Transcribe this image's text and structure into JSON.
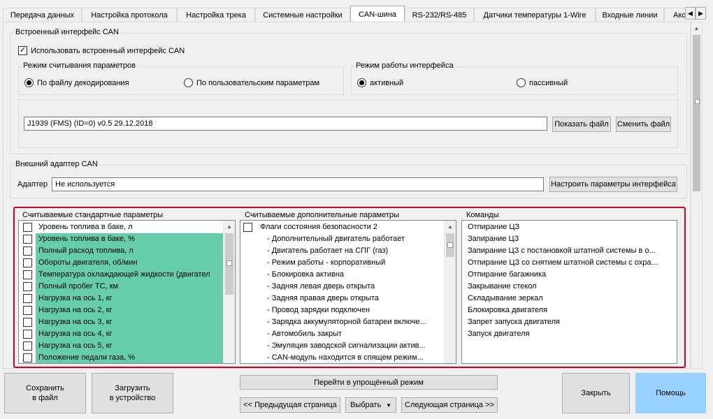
{
  "tabs": [
    {
      "label": "Передача данных",
      "active": false
    },
    {
      "label": "Настройка протокола",
      "active": false
    },
    {
      "label": "Настройка трека",
      "active": false
    },
    {
      "label": "Системные настройки",
      "active": false
    },
    {
      "label": "CAN-шина",
      "active": true
    },
    {
      "label": "RS-232/RS-485",
      "active": false
    },
    {
      "label": "Датчики температуры 1-Wire",
      "active": false
    },
    {
      "label": "Входные линии",
      "active": false
    },
    {
      "label": "Акс",
      "active": false
    }
  ],
  "builtin": {
    "title": "Встроенный интерфейс CAN",
    "use_checkbox_label": "Использовать встроенный интерфейс CAN",
    "use_checked": true,
    "read_mode": {
      "title": "Режим считывания параметров",
      "options": [
        "По файлу декодирования",
        "По пользовательским параметрам"
      ],
      "selected": 0
    },
    "work_mode": {
      "title": "Режим работы интерфейса",
      "options": [
        "активный",
        "пассивный"
      ],
      "selected": 0
    },
    "file_value": "J1939 (FMS) (ID=0) v0.5 29.12.2018",
    "show_file_button": "Показать файл",
    "change_file_button": "Сменить файл"
  },
  "external": {
    "title": "Внешний адаптер CAN",
    "adapter_label": "Адаптер",
    "adapter_value": "Не используется",
    "configure_button": "Настроить параметры интерфейса"
  },
  "standard_params": {
    "title": "Считываемые стандартные параметры",
    "items": [
      {
        "label": "Уровень топлива в баке, л",
        "checked": false,
        "highlighted": false
      },
      {
        "label": "Уровень топлива в баке, %",
        "checked": false,
        "highlighted": true
      },
      {
        "label": "Полный расход топлива, л",
        "checked": false,
        "highlighted": true
      },
      {
        "label": "Обороты двигателя, об/мин",
        "checked": false,
        "highlighted": true
      },
      {
        "label": "Температура охлаждающей жидкости (двигател",
        "checked": false,
        "highlighted": true
      },
      {
        "label": "Полный пробег ТС, км",
        "checked": false,
        "highlighted": true
      },
      {
        "label": "Нагрузка на ось 1, кг",
        "checked": false,
        "highlighted": true
      },
      {
        "label": "Нагрузка на ось 2, кг",
        "checked": false,
        "highlighted": true
      },
      {
        "label": "Нагрузка на ось 3, кг",
        "checked": false,
        "highlighted": true
      },
      {
        "label": "Нагрузка на ось 4, кг",
        "checked": false,
        "highlighted": true
      },
      {
        "label": "Нагрузка на ось 5, кг",
        "checked": false,
        "highlighted": true
      },
      {
        "label": "Положение педали газа, %",
        "checked": false,
        "highlighted": true
      }
    ]
  },
  "extra_params": {
    "title": "Считываемые дополнительные параметры",
    "group_label": "Флаги состояния безопасности 2",
    "group_checked": false,
    "items": [
      "- Дополнительный двигатель работает",
      "- Двигатель работает на СПГ (газ)",
      "- Режим работы - корпоративный",
      "- Блокировка активна",
      "- Задняя левая дверь открыта",
      "- Задняя правая дверь открыта",
      "- Провод зарядки подключен",
      "- Зарядка аккумуляторной батареи включе...",
      "- Автомобиль закрыт",
      "- Эмуляция заводской сигнализации актив...",
      "- CAN-модуль находится в спящем режим..."
    ]
  },
  "commands": {
    "title": "Команды",
    "items": [
      "Отпирание ЦЗ",
      "Запирание ЦЗ",
      "Запирание ЦЗ с постановкой штатной системы в о...",
      "Отпирание ЦЗ со снятием штатной системы с охра...",
      "Отпирание багажника",
      "Закрывание стекол",
      "Складывание зеркал",
      "Блокировка двигателя",
      "Запрет запуска двигателя",
      "Запуск двигателя"
    ]
  },
  "bottom": {
    "save_file": "Сохранить\nв файл",
    "load_device": "Загрузить\nв устройство",
    "simple_mode": "Перейти в упрощённый режим",
    "prev_page": "<< Предыдущая страница",
    "select": "Выбрать",
    "next_page": "Следующая страница >>",
    "close": "Закрыть",
    "help": "Помощь"
  },
  "colors": {
    "highlight": "#66cdaa",
    "red_frame": "#d0021b",
    "help_button": "#99d1ff"
  }
}
